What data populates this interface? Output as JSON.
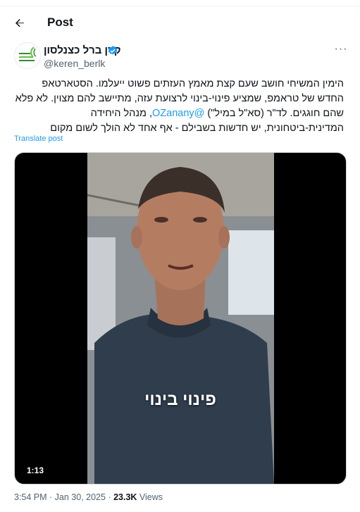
{
  "header": {
    "title": "Post"
  },
  "author": {
    "name": "קרן ברל כצנלסון",
    "handle": "@keren_berlk",
    "avatar_text": [
      "ברל",
      "כצנלסון"
    ]
  },
  "post": {
    "text_before_mention": "הימין המשיחי חושב שעם קצת מאמץ העזתים פשוט ייעלמו. הסטארטאפ החדש של טראמפ, שמציע פינוי-בינוי לרצועת עזה, מתיישב להם מצוין. לא פלא שהם חוגגים. לד\"ר (סא\"ל במיל\") ",
    "mention": "@OZanany",
    "text_after_mention": ", מנהל היחידה המדינית-ביטחונית, יש חדשות בשבילם - אף אחד לא הולך לשום מקום",
    "translate_label": "Translate post"
  },
  "video": {
    "caption": "פינוי בינוי",
    "duration": "1:13"
  },
  "meta": {
    "time": "3:54 PM",
    "separator": " · ",
    "date": "Jan 30, 2025",
    "views": "23.3K",
    "views_label": " Views"
  },
  "colors": {
    "accent": "#1d9bf0",
    "text": "#0f1419",
    "muted": "#536471"
  }
}
